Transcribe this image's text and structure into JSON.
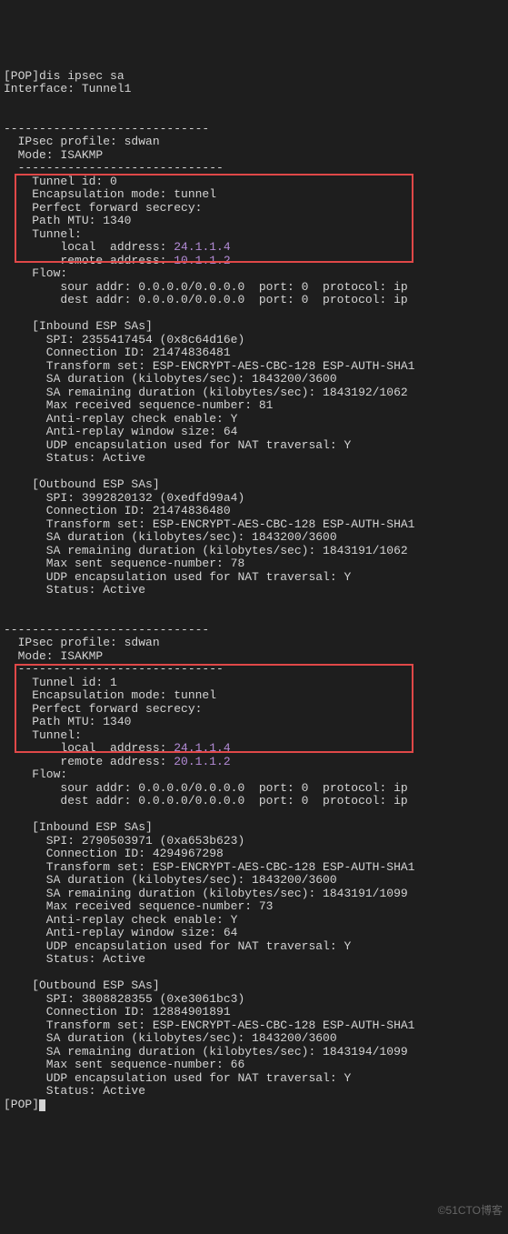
{
  "top": {
    "prompt": "[POP]dis ipsec sa",
    "interface": "Interface: Tunnel1"
  },
  "sep": "-----------------------------",
  "profile": {
    "name": "  IPsec profile: sdwan",
    "mode": "  Mode: ISAKMP",
    "sep2": "  -----------------------------"
  },
  "t0": {
    "id": "    Tunnel id: 0",
    "enc": "    Encapsulation mode: tunnel",
    "pfs": "    Perfect forward secrecy:",
    "mtu": "    Path MTU: 1340",
    "tun": "    Tunnel:",
    "la": "        local  address:",
    "lav": " 24.1.1.4",
    "ra": "        remote address:",
    "rav": " 10.1.1.2",
    "flow": "    Flow:",
    "sa": "        sour addr: 0.0.0.0/0.0.0.0  port: 0  protocol: ip",
    "da": "        dest addr: 0.0.0.0/0.0.0.0  port: 0  protocol: ip"
  },
  "in0": {
    "h": "    [Inbound ESP SAs]",
    "spi": "      SPI: 2355417454 (0x8c64d16e)",
    "cid": "      Connection ID: 21474836481",
    "ts": "      Transform set: ESP-ENCRYPT-AES-CBC-128 ESP-AUTH-SHA1",
    "sd": "      SA duration (kilobytes/sec): 1843200/3600",
    "sr": "      SA remaining duration (kilobytes/sec): 1843192/1062",
    "mr": "      Max received sequence-number: 81",
    "ar": "      Anti-replay check enable: Y",
    "aw": "      Anti-replay window size: 64",
    "nat": "      UDP encapsulation used for NAT traversal: Y",
    "st": "      Status: Active"
  },
  "out0": {
    "h": "    [Outbound ESP SAs]",
    "spi": "      SPI: 3992820132 (0xedfd99a4)",
    "cid": "      Connection ID: 21474836480",
    "ts": "      Transform set: ESP-ENCRYPT-AES-CBC-128 ESP-AUTH-SHA1",
    "sd": "      SA duration (kilobytes/sec): 1843200/3600",
    "sr": "      SA remaining duration (kilobytes/sec): 1843191/1062",
    "ms": "      Max sent sequence-number: 78",
    "nat": "      UDP encapsulation used for NAT traversal: Y",
    "st": "      Status: Active"
  },
  "t1": {
    "id": "    Tunnel id: 1",
    "enc": "    Encapsulation mode: tunnel",
    "pfs": "    Perfect forward secrecy:",
    "mtu": "    Path MTU: 1340",
    "tun": "    Tunnel:",
    "la": "        local  address:",
    "lav": " 24.1.1.4",
    "ra": "        remote address:",
    "rav": " 20.1.1.2",
    "flow": "    Flow:",
    "sa": "        sour addr: 0.0.0.0/0.0.0.0  port: 0  protocol: ip",
    "da": "        dest addr: 0.0.0.0/0.0.0.0  port: 0  protocol: ip"
  },
  "in1": {
    "h": "    [Inbound ESP SAs]",
    "spi": "      SPI: 2790503971 (0xa653b623)",
    "cid": "      Connection ID: 4294967298",
    "ts": "      Transform set: ESP-ENCRYPT-AES-CBC-128 ESP-AUTH-SHA1",
    "sd": "      SA duration (kilobytes/sec): 1843200/3600",
    "sr": "      SA remaining duration (kilobytes/sec): 1843191/1099",
    "mr": "      Max received sequence-number: 73",
    "ar": "      Anti-replay check enable: Y",
    "aw": "      Anti-replay window size: 64",
    "nat": "      UDP encapsulation used for NAT traversal: Y",
    "st": "      Status: Active"
  },
  "out1": {
    "h": "    [Outbound ESP SAs]",
    "spi": "      SPI: 3808828355 (0xe3061bc3)",
    "cid": "      Connection ID: 12884901891",
    "ts": "      Transform set: ESP-ENCRYPT-AES-CBC-128 ESP-AUTH-SHA1",
    "sd": "      SA duration (kilobytes/sec): 1843200/3600",
    "sr": "      SA remaining duration (kilobytes/sec): 1843194/1099",
    "ms": "      Max sent sequence-number: 66",
    "nat": "      UDP encapsulation used for NAT traversal: Y",
    "st": "      Status: Active"
  },
  "end": {
    "prompt": "[POP]"
  },
  "watermark": "©51CTO博客"
}
